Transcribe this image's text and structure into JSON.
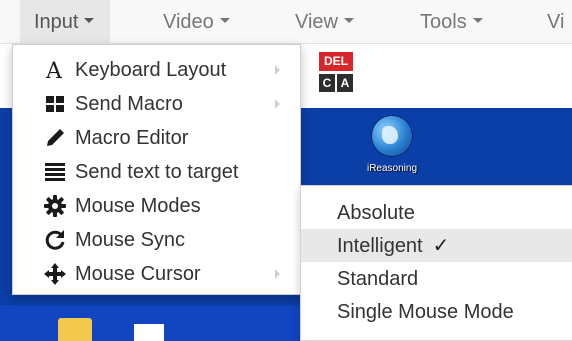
{
  "menubar": {
    "items": [
      {
        "label": "Input"
      },
      {
        "label": "Video"
      },
      {
        "label": "View"
      },
      {
        "label": "Tools"
      },
      {
        "label": "Vi"
      }
    ]
  },
  "input_menu": {
    "items": [
      {
        "label": "Keyboard Layout",
        "icon": "letter-a-icon",
        "has_submenu": true
      },
      {
        "label": "Send Macro",
        "icon": "grid-icon",
        "has_submenu": true
      },
      {
        "label": "Macro Editor",
        "icon": "pencil-icon",
        "has_submenu": false
      },
      {
        "label": "Send text to target",
        "icon": "list-icon",
        "has_submenu": false
      },
      {
        "label": "Mouse Modes",
        "icon": "gear-icon",
        "has_submenu": false
      },
      {
        "label": "Mouse Sync",
        "icon": "refresh-icon",
        "has_submenu": false
      },
      {
        "label": "Mouse Cursor",
        "icon": "move-arrows-icon",
        "has_submenu": true
      }
    ]
  },
  "mouse_modes_submenu": {
    "items": [
      {
        "label": "Absolute",
        "selected": false
      },
      {
        "label": "Intelligent",
        "selected": true
      },
      {
        "label": "Standard",
        "selected": false
      },
      {
        "label": "Single Mouse Mode",
        "selected": false
      }
    ],
    "check_glyph": "✓"
  },
  "toolbar": {
    "ctrl_alt_del": {
      "top": "DEL",
      "left_key": "C",
      "right_key": "A"
    }
  },
  "desktop": {
    "icon_label": "iReasoning"
  },
  "colors": {
    "desktop_blue": "#0b3fa8",
    "menubar_bg": "#f8f8f8",
    "del_red": "#d9262b",
    "active_item_bg": "#e8e8e8"
  }
}
